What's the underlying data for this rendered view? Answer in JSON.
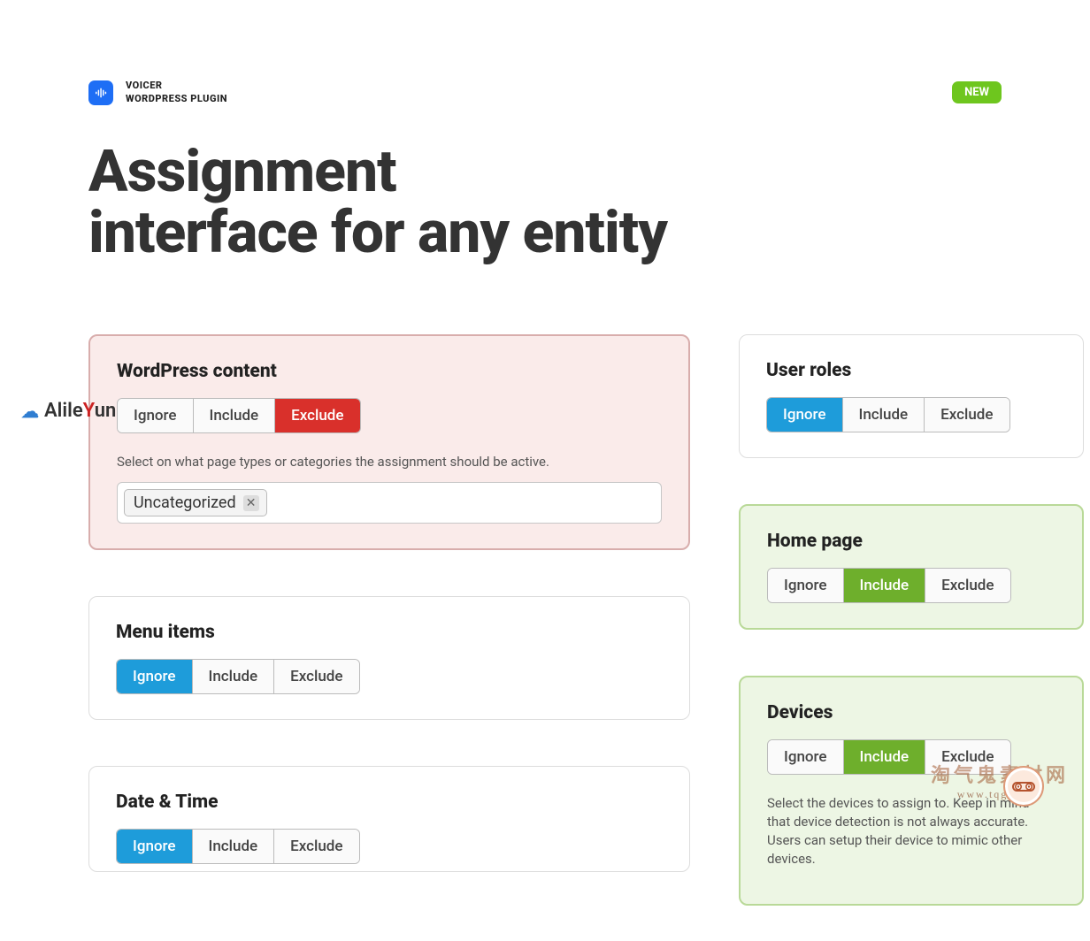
{
  "brand": {
    "line1": "VOICER",
    "line2": "WORDPRESS PLUGIN"
  },
  "badge": "NEW",
  "title_line1": "Assignment",
  "title_line2": "interface for any entity",
  "buttons": {
    "ignore": "Ignore",
    "include": "Include",
    "exclude": "Exclude"
  },
  "cards": {
    "wp_content": {
      "heading": "WordPress content",
      "helper": "Select on what page types or categories the assignment should be active.",
      "chip": "Uncategorized"
    },
    "menu_items": {
      "heading": "Menu items"
    },
    "date_time": {
      "heading": "Date & Time"
    },
    "user_roles": {
      "heading": "User roles"
    },
    "home_page": {
      "heading": "Home page"
    },
    "devices": {
      "heading": "Devices",
      "helper": "Select the devices to assign to. Keep in mind that device detection is not always accurate. Users can setup their device to mimic other devices."
    }
  },
  "watermarks": {
    "left_text_a": "Alile",
    "left_text_y": "Y",
    "left_text_b": "un",
    "br_cn": "淘气鬼素材网",
    "br_url": "www.tqge.com"
  }
}
